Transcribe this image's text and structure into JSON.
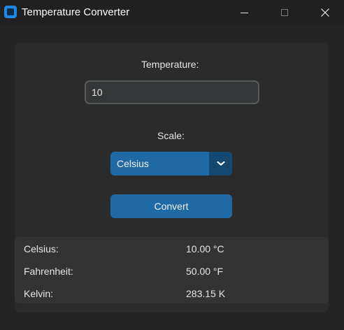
{
  "window": {
    "title": "Temperature Converter",
    "icon": "app-icon"
  },
  "form": {
    "temperature_label": "Temperature:",
    "temperature_value": "10",
    "scale_label": "Scale:",
    "scale_selected": "Celsius",
    "convert_label": "Convert"
  },
  "results": [
    {
      "label": "Celsius:",
      "value": "10.00 °C"
    },
    {
      "label": "Fahrenheit:",
      "value": "50.00 °F"
    },
    {
      "label": "Kelvin:",
      "value": "283.15 K"
    }
  ],
  "colors": {
    "accent": "#1f6aa5",
    "accent_dark": "#144870",
    "background": "#242424",
    "frame": "#2b2b2b",
    "result_panel": "#333333"
  }
}
